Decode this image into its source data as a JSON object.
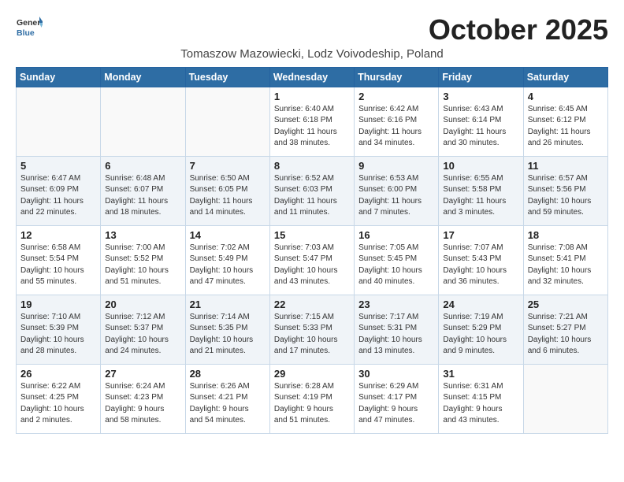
{
  "header": {
    "logo_general": "General",
    "logo_blue": "Blue",
    "month_title": "October 2025",
    "subtitle": "Tomaszow Mazowiecki, Lodz Voivodeship, Poland"
  },
  "weekdays": [
    "Sunday",
    "Monday",
    "Tuesday",
    "Wednesday",
    "Thursday",
    "Friday",
    "Saturday"
  ],
  "weeks": [
    [
      {
        "day": "",
        "info": ""
      },
      {
        "day": "",
        "info": ""
      },
      {
        "day": "",
        "info": ""
      },
      {
        "day": "1",
        "info": "Sunrise: 6:40 AM\nSunset: 6:18 PM\nDaylight: 11 hours\nand 38 minutes."
      },
      {
        "day": "2",
        "info": "Sunrise: 6:42 AM\nSunset: 6:16 PM\nDaylight: 11 hours\nand 34 minutes."
      },
      {
        "day": "3",
        "info": "Sunrise: 6:43 AM\nSunset: 6:14 PM\nDaylight: 11 hours\nand 30 minutes."
      },
      {
        "day": "4",
        "info": "Sunrise: 6:45 AM\nSunset: 6:12 PM\nDaylight: 11 hours\nand 26 minutes."
      }
    ],
    [
      {
        "day": "5",
        "info": "Sunrise: 6:47 AM\nSunset: 6:09 PM\nDaylight: 11 hours\nand 22 minutes."
      },
      {
        "day": "6",
        "info": "Sunrise: 6:48 AM\nSunset: 6:07 PM\nDaylight: 11 hours\nand 18 minutes."
      },
      {
        "day": "7",
        "info": "Sunrise: 6:50 AM\nSunset: 6:05 PM\nDaylight: 11 hours\nand 14 minutes."
      },
      {
        "day": "8",
        "info": "Sunrise: 6:52 AM\nSunset: 6:03 PM\nDaylight: 11 hours\nand 11 minutes."
      },
      {
        "day": "9",
        "info": "Sunrise: 6:53 AM\nSunset: 6:00 PM\nDaylight: 11 hours\nand 7 minutes."
      },
      {
        "day": "10",
        "info": "Sunrise: 6:55 AM\nSunset: 5:58 PM\nDaylight: 11 hours\nand 3 minutes."
      },
      {
        "day": "11",
        "info": "Sunrise: 6:57 AM\nSunset: 5:56 PM\nDaylight: 10 hours\nand 59 minutes."
      }
    ],
    [
      {
        "day": "12",
        "info": "Sunrise: 6:58 AM\nSunset: 5:54 PM\nDaylight: 10 hours\nand 55 minutes."
      },
      {
        "day": "13",
        "info": "Sunrise: 7:00 AM\nSunset: 5:52 PM\nDaylight: 10 hours\nand 51 minutes."
      },
      {
        "day": "14",
        "info": "Sunrise: 7:02 AM\nSunset: 5:49 PM\nDaylight: 10 hours\nand 47 minutes."
      },
      {
        "day": "15",
        "info": "Sunrise: 7:03 AM\nSunset: 5:47 PM\nDaylight: 10 hours\nand 43 minutes."
      },
      {
        "day": "16",
        "info": "Sunrise: 7:05 AM\nSunset: 5:45 PM\nDaylight: 10 hours\nand 40 minutes."
      },
      {
        "day": "17",
        "info": "Sunrise: 7:07 AM\nSunset: 5:43 PM\nDaylight: 10 hours\nand 36 minutes."
      },
      {
        "day": "18",
        "info": "Sunrise: 7:08 AM\nSunset: 5:41 PM\nDaylight: 10 hours\nand 32 minutes."
      }
    ],
    [
      {
        "day": "19",
        "info": "Sunrise: 7:10 AM\nSunset: 5:39 PM\nDaylight: 10 hours\nand 28 minutes."
      },
      {
        "day": "20",
        "info": "Sunrise: 7:12 AM\nSunset: 5:37 PM\nDaylight: 10 hours\nand 24 minutes."
      },
      {
        "day": "21",
        "info": "Sunrise: 7:14 AM\nSunset: 5:35 PM\nDaylight: 10 hours\nand 21 minutes."
      },
      {
        "day": "22",
        "info": "Sunrise: 7:15 AM\nSunset: 5:33 PM\nDaylight: 10 hours\nand 17 minutes."
      },
      {
        "day": "23",
        "info": "Sunrise: 7:17 AM\nSunset: 5:31 PM\nDaylight: 10 hours\nand 13 minutes."
      },
      {
        "day": "24",
        "info": "Sunrise: 7:19 AM\nSunset: 5:29 PM\nDaylight: 10 hours\nand 9 minutes."
      },
      {
        "day": "25",
        "info": "Sunrise: 7:21 AM\nSunset: 5:27 PM\nDaylight: 10 hours\nand 6 minutes."
      }
    ],
    [
      {
        "day": "26",
        "info": "Sunrise: 6:22 AM\nSunset: 4:25 PM\nDaylight: 10 hours\nand 2 minutes."
      },
      {
        "day": "27",
        "info": "Sunrise: 6:24 AM\nSunset: 4:23 PM\nDaylight: 9 hours\nand 58 minutes."
      },
      {
        "day": "28",
        "info": "Sunrise: 6:26 AM\nSunset: 4:21 PM\nDaylight: 9 hours\nand 54 minutes."
      },
      {
        "day": "29",
        "info": "Sunrise: 6:28 AM\nSunset: 4:19 PM\nDaylight: 9 hours\nand 51 minutes."
      },
      {
        "day": "30",
        "info": "Sunrise: 6:29 AM\nSunset: 4:17 PM\nDaylight: 9 hours\nand 47 minutes."
      },
      {
        "day": "31",
        "info": "Sunrise: 6:31 AM\nSunset: 4:15 PM\nDaylight: 9 hours\nand 43 minutes."
      },
      {
        "day": "",
        "info": ""
      }
    ]
  ]
}
